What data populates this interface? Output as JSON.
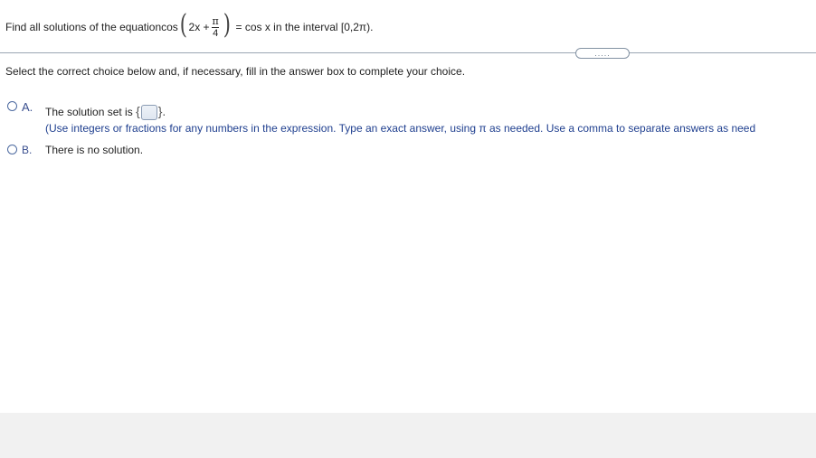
{
  "question": {
    "prefix": "Find all solutions of the equation ",
    "cos_label": "cos",
    "inner_expr": "2x +",
    "pi_symbol": "π",
    "frac_den": "4",
    "rhs": "= cos x in the interval [0,2π)."
  },
  "more_button": {
    "label": "....."
  },
  "instruction": "Select the correct choice below and, if necessary, fill in the answer box to complete your choice.",
  "choices": [
    {
      "letter": "A.",
      "text": "The solution set is",
      "brace_open": "{",
      "brace_close": "}.",
      "hint": "(Use integers or fractions for any numbers in the expression. Type an exact answer, using π as needed. Use a comma to separate answers as need"
    },
    {
      "letter": "B.",
      "text": "There is no solution."
    }
  ],
  "colors": {
    "accent": "#3a4f8f",
    "hint_text": "#1f3f8f",
    "divider": "#9aa6b2"
  }
}
